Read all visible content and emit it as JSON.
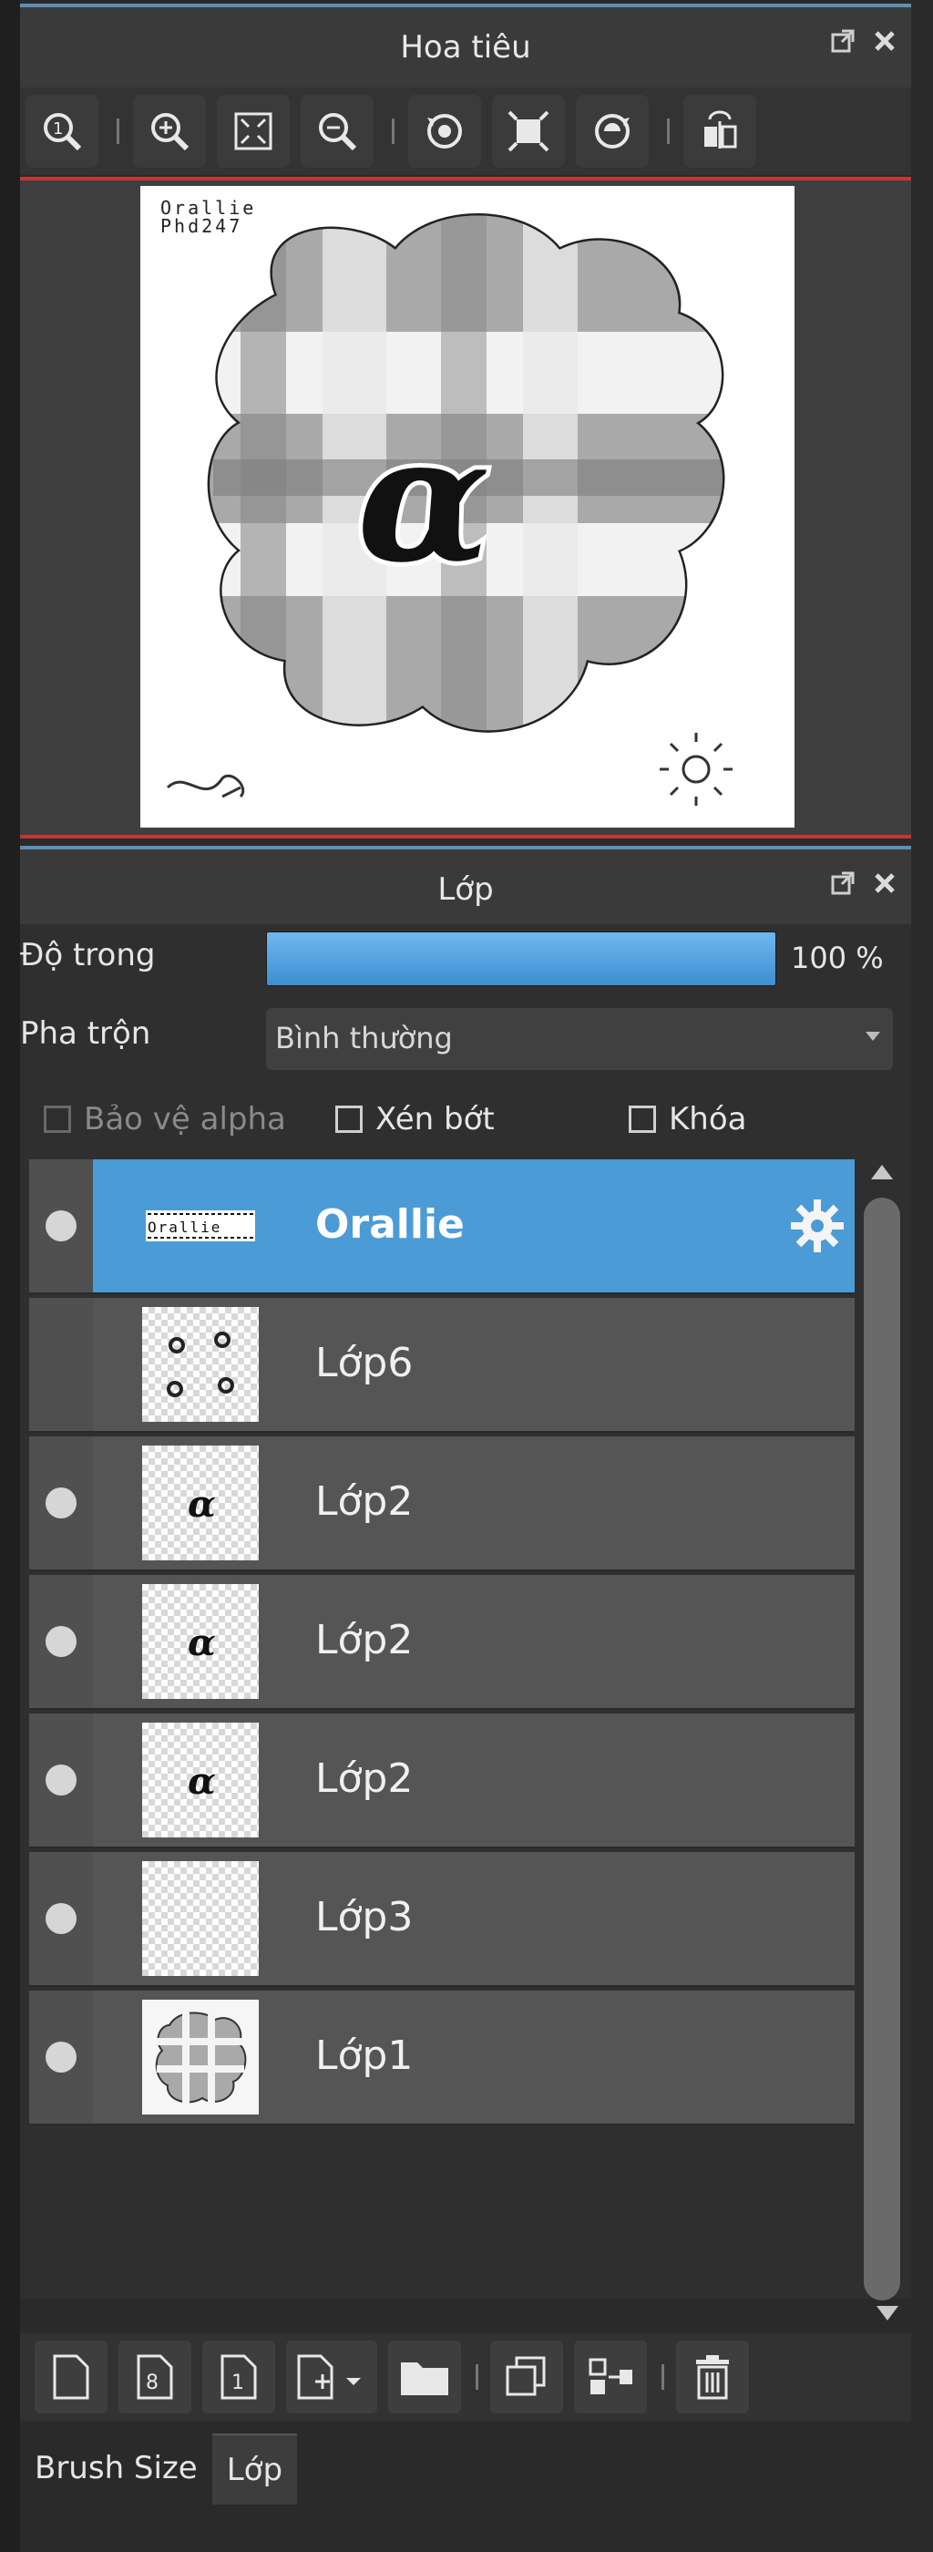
{
  "navigator": {
    "title": "Hoa tiêu",
    "toolbar": [
      "zoom-100-icon",
      "zoom-in-icon",
      "fit-screen-icon",
      "zoom-out-icon",
      "rotate-left-icon",
      "fit-window-icon",
      "rotate-right-icon",
      "flip-horizontal-icon"
    ],
    "canvas_caption": "Orallie\nPhd247",
    "glyph": "α"
  },
  "layers_panel": {
    "title": "Lớp",
    "opacity_label": "Độ trong",
    "opacity_value": "100 %",
    "opacity": 1.0,
    "blend_label": "Pha trộn",
    "blend_value": "Bình thường",
    "protect_alpha": "Bảo vệ alpha",
    "clipping": "Xén bớt",
    "lock": "Khóa",
    "layers": [
      {
        "name": "Orallie",
        "visible": true,
        "selected": true
      },
      {
        "name": "Lớp6",
        "visible": false,
        "selected": false
      },
      {
        "name": "Lớp2",
        "visible": true,
        "selected": false
      },
      {
        "name": "Lớp2",
        "visible": true,
        "selected": false
      },
      {
        "name": "Lớp2",
        "visible": true,
        "selected": false
      },
      {
        "name": "Lớp3",
        "visible": true,
        "selected": false
      },
      {
        "name": "Lớp1",
        "visible": true,
        "selected": false
      }
    ],
    "bottom_toolbar": [
      "new-layer-icon",
      "new-8bit-layer-icon",
      "new-1bit-layer-icon",
      "add-layer-menu-icon",
      "new-folder-icon",
      "duplicate-layer-icon",
      "merge-down-icon",
      "delete-layer-icon"
    ]
  },
  "tabs": {
    "brush_size": "Brush Size",
    "layer": "Lớp"
  },
  "colors": {
    "accent": "#4b9bd6",
    "panel_border": "#5f8fb5",
    "view_border": "#c43535"
  }
}
